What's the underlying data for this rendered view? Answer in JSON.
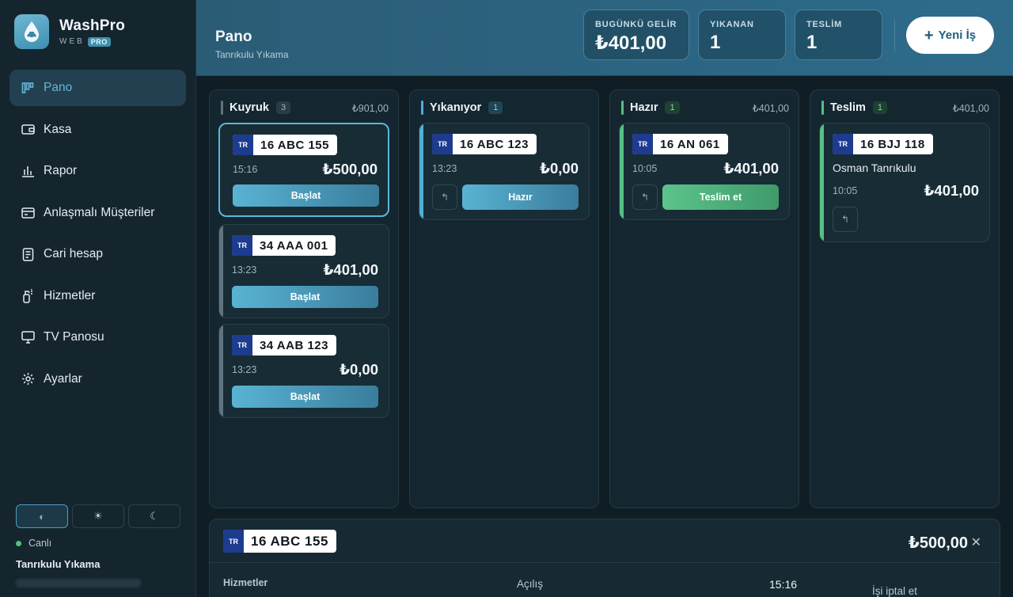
{
  "brand": {
    "name": "WashPro",
    "sub": "WEB",
    "badge": "PRO"
  },
  "nav": [
    {
      "label": "Pano",
      "icon": "board-icon",
      "active": true
    },
    {
      "label": "Kasa",
      "icon": "wallet-icon"
    },
    {
      "label": "Rapor",
      "icon": "bar-chart-icon"
    },
    {
      "label": "Anlaşmalı Müşteriler",
      "icon": "card-icon"
    },
    {
      "label": "Cari hesap",
      "icon": "ledger-icon"
    },
    {
      "label": "Hizmetler",
      "icon": "spray-bottle-icon"
    },
    {
      "label": "TV Panosu",
      "icon": "monitor-icon"
    },
    {
      "label": "Ayarlar",
      "icon": "gear-icon"
    }
  ],
  "theme": {
    "options": [
      "contrast-icon",
      "sun-icon",
      "moon-icon"
    ],
    "active": "contrast-icon"
  },
  "status": {
    "label": "Canlı"
  },
  "shop": {
    "name": "Tanrıkulu Yıkama"
  },
  "header": {
    "title": "Pano",
    "subtitle": "Tanrıkulu Yıkama",
    "stats": [
      {
        "label": "BUGÜNKÜ GELİR",
        "value": "₺401,00"
      },
      {
        "label": "YIKANAN",
        "value": "1"
      },
      {
        "label": "TESLİM",
        "value": "1"
      }
    ],
    "new_job": "Yeni İş"
  },
  "columns": [
    {
      "name": "Kuyruk",
      "count": "3",
      "total": "₺901,00",
      "color": "#5f7480",
      "cards": [
        {
          "plate_cc": "TR",
          "plate": "16 ABC 155",
          "time": "15:16",
          "amount": "₺500,00",
          "action": "Başlat",
          "selected": true
        },
        {
          "plate_cc": "TR",
          "plate": "34 AAA 001",
          "time": "13:23",
          "amount": "₺401,00",
          "action": "Başlat"
        },
        {
          "plate_cc": "TR",
          "plate": "34 AAB 123",
          "time": "13:23",
          "amount": "₺0,00",
          "action": "Başlat"
        }
      ]
    },
    {
      "name": "Yıkanıyor",
      "count": "1",
      "total": "",
      "color": "#4fb0d6",
      "cards": [
        {
          "plate_cc": "TR",
          "plate": "16 ABC 123",
          "time": "13:23",
          "amount": "₺0,00",
          "action": "Hazır"
        }
      ]
    },
    {
      "name": "Hazır",
      "count": "1",
      "total": "₺401,00",
      "color": "#55c184",
      "cards": [
        {
          "plate_cc": "TR",
          "plate": "16 AN 061",
          "time": "10:05",
          "amount": "₺401,00",
          "action": "Teslim et"
        }
      ]
    },
    {
      "name": "Teslim",
      "count": "1",
      "total": "₺401,00",
      "color": "#55c184",
      "cards": [
        {
          "plate_cc": "TR",
          "plate": "16 BJJ 118",
          "customer": "Osman Tanrıkulu",
          "time": "10:05",
          "amount": "₺401,00"
        }
      ]
    }
  ],
  "detail": {
    "plate_cc": "TR",
    "plate": "16 ABC 155",
    "amount": "₺500,00",
    "services_label": "Hizmetler",
    "opening_label": "Açılış",
    "opening_time": "15:16",
    "cancel": "İşi iptal et"
  }
}
